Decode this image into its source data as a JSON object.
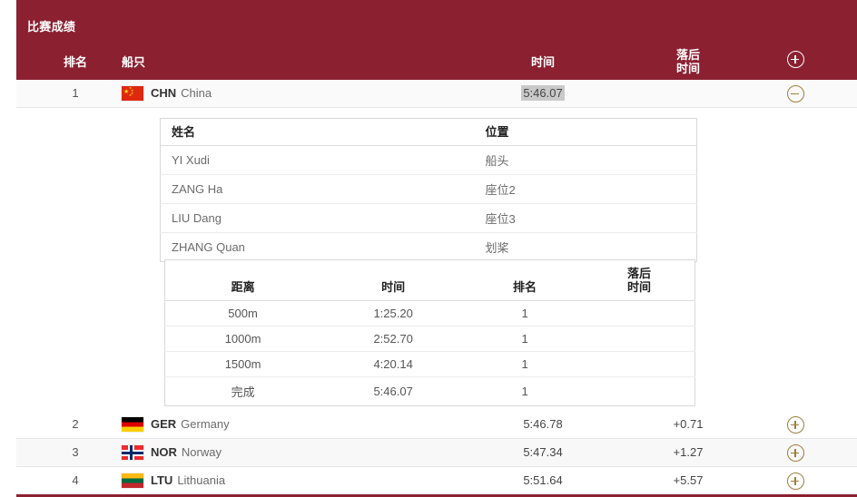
{
  "widget": {
    "title": "比赛成绩",
    "accent_color": "#8b2031",
    "gold_color": "#9d7d39"
  },
  "columns": {
    "rank": "排名",
    "boat": "船只",
    "time": "时间",
    "behind_line1": "落后",
    "behind_line2": "时间",
    "toggle_icon": "plus-circle-icon"
  },
  "rows": [
    {
      "rank": "1",
      "noc": "CHN",
      "country": "China",
      "flag": "flag-china",
      "time": "5:46.07",
      "behind": "",
      "expanded": true,
      "toggle_icon": "minus-circle-icon"
    },
    {
      "rank": "2",
      "noc": "GER",
      "country": "Germany",
      "flag": "flag-germany",
      "time": "5:46.78",
      "behind": "+0.71",
      "expanded": false,
      "toggle_icon": "plus-circle-icon"
    },
    {
      "rank": "3",
      "noc": "NOR",
      "country": "Norway",
      "flag": "flag-norway",
      "time": "5:47.34",
      "behind": "+1.27",
      "expanded": false,
      "toggle_icon": "plus-circle-icon"
    },
    {
      "rank": "4",
      "noc": "LTU",
      "country": "Lithuania",
      "flag": "flag-lithuania",
      "time": "5:51.64",
      "behind": "+5.57",
      "expanded": false,
      "toggle_icon": "plus-circle-icon"
    }
  ],
  "crew_table": {
    "headers": {
      "name": "姓名",
      "position": "位置"
    },
    "rows": [
      {
        "name": "YI Xudi",
        "position": "船头"
      },
      {
        "name": "ZANG Ha",
        "position": "座位2"
      },
      {
        "name": "LIU Dang",
        "position": "座位3"
      },
      {
        "name": "ZHANG Quan",
        "position": "划桨"
      }
    ]
  },
  "splits_table": {
    "headers": {
      "distance": "距离",
      "time": "时间",
      "rank": "排名",
      "behind_line1": "落后",
      "behind_line2": "时间"
    },
    "rows": [
      {
        "distance": "500m",
        "time": "1:25.20",
        "rank": "1",
        "behind": ""
      },
      {
        "distance": "1000m",
        "time": "2:52.70",
        "rank": "1",
        "behind": ""
      },
      {
        "distance": "1500m",
        "time": "4:20.14",
        "rank": "1",
        "behind": ""
      },
      {
        "distance": "完成",
        "time": "5:46.07",
        "rank": "1",
        "behind": ""
      }
    ]
  }
}
